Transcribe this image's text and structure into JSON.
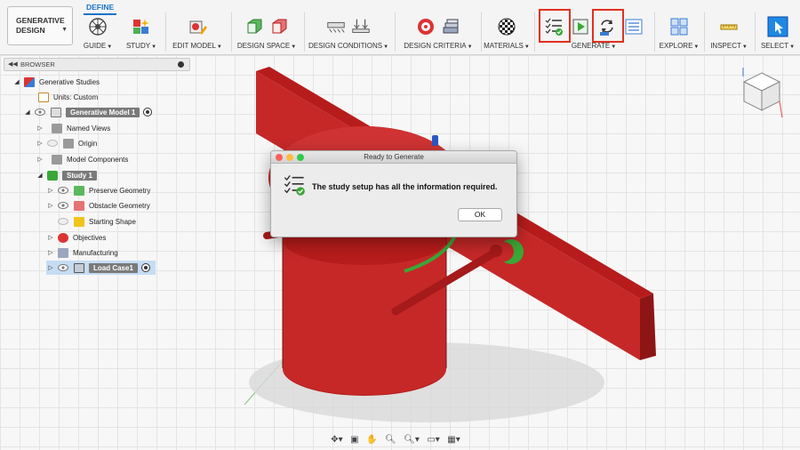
{
  "workspace": {
    "label": "GENERATIVE DESIGN"
  },
  "active_tab": "DEFINE",
  "toolbar_groups": [
    {
      "id": "guide",
      "label": "GUIDE",
      "icons": [
        "guide-wheel-icon"
      ]
    },
    {
      "id": "study",
      "label": "STUDY",
      "icons": [
        "study-icon"
      ]
    },
    {
      "id": "edit_model",
      "label": "EDIT MODEL",
      "icons": [
        "edit-model-icon"
      ]
    },
    {
      "id": "design_space",
      "label": "DESIGN SPACE",
      "icons": [
        "preserve-geometry-icon",
        "obstacle-geometry-icon"
      ]
    },
    {
      "id": "design_conditions",
      "label": "DESIGN CONDITIONS",
      "icons": [
        "structural-constraint-icon",
        "structural-load-icon"
      ]
    },
    {
      "id": "design_criteria",
      "label": "DESIGN CRITERIA",
      "icons": [
        "objectives-icon",
        "manufacturing-icon"
      ]
    },
    {
      "id": "materials",
      "label": "MATERIALS",
      "icons": [
        "materials-icon"
      ]
    },
    {
      "id": "generate",
      "label": "GENERATE",
      "icons": [
        "pre-check-icon",
        "preview-icon",
        "sync-icon",
        "generate-list-icon"
      ]
    },
    {
      "id": "explore",
      "label": "EXPLORE",
      "icons": [
        "explore-icon"
      ]
    },
    {
      "id": "inspect",
      "label": "INSPECT",
      "icons": [
        "measure-icon"
      ]
    },
    {
      "id": "select",
      "label": "SELECT",
      "icons": [
        "select-cursor-icon"
      ]
    }
  ],
  "browser": {
    "title": "BROWSER",
    "items": [
      {
        "label": "Generative Studies"
      },
      {
        "label": "Units: Custom"
      },
      {
        "label": "Generative Model 1"
      },
      {
        "label": "Named Views"
      },
      {
        "label": "Origin"
      },
      {
        "label": "Model Components"
      },
      {
        "label": "Study 1"
      },
      {
        "label": "Preserve Geometry"
      },
      {
        "label": "Obstacle Geometry"
      },
      {
        "label": "Starting Shape"
      },
      {
        "label": "Objectives"
      },
      {
        "label": "Manufacturing"
      },
      {
        "label": "Load Case1"
      }
    ]
  },
  "dialog": {
    "title": "Ready to Generate",
    "message": "The study setup has all the information required.",
    "ok_label": "OK"
  },
  "colors": {
    "accent": "#1a73c8",
    "highlight_box": "#e0311f",
    "model_red": "#b52020",
    "preserve_green": "#3aa836"
  }
}
